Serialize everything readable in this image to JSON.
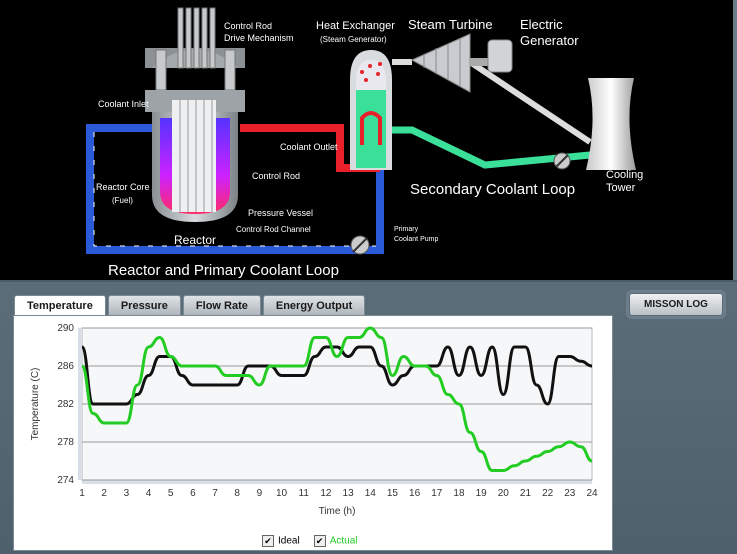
{
  "diagram": {
    "labels": {
      "control_rod_drive": [
        "Control Rod",
        "Drive Mechanism"
      ],
      "heat_exchanger": "Heat Exchanger",
      "steam_generator": "(Steam Generator)",
      "steam_turbine": "Steam Turbine",
      "electric_generator": [
        "Electric",
        "Generator"
      ],
      "coolant_inlet": "Coolant Inlet",
      "coolant_outlet": "Coolant Outlet",
      "control_rod": "Control Rod",
      "reactor_core": [
        "Reactor Core",
        "(Fuel)"
      ],
      "pressure_vessel": "Pressure Vessel",
      "control_rod_channel": "Control Rod Channel",
      "reactor": "Reactor",
      "primary_pump": [
        "Primary",
        "Coolant Pump"
      ],
      "secondary_loop": "Secondary Coolant Loop",
      "cooling_tower": [
        "Cooling",
        "Tower"
      ],
      "primary_loop": "Reactor and Primary Coolant Loop"
    },
    "colors": {
      "primary_hot": "#e8202a",
      "primary_cold": "#2a5ad8",
      "secondary": "#3adf9a"
    }
  },
  "tabs": [
    "Temperature",
    "Pressure",
    "Flow Rate",
    "Energy Output"
  ],
  "active_tab": "Temperature",
  "mission_log_label": "MISSON LOG",
  "legend": {
    "ideal": "Ideal",
    "actual": "Actual"
  },
  "chart_data": {
    "type": "line",
    "xlabel": "Time (h)",
    "ylabel": "Temperature (C)",
    "x": [
      1,
      1.5,
      2,
      2.5,
      3,
      3.5,
      4,
      4.5,
      5,
      5.5,
      6,
      6.5,
      7,
      7.5,
      8,
      8.5,
      9,
      9.5,
      10,
      10.5,
      11,
      11.5,
      12,
      12.5,
      13,
      13.5,
      14,
      14.5,
      15,
      15.5,
      16,
      16.5,
      17,
      17.5,
      18,
      18.5,
      19,
      19.5,
      20,
      20.5,
      21,
      21.5,
      22,
      22.5,
      23,
      23.5,
      24
    ],
    "xlim": [
      1,
      24
    ],
    "ylim": [
      274,
      290
    ],
    "yticks": [
      274,
      278,
      282,
      286,
      290
    ],
    "series": [
      {
        "name": "Ideal",
        "color": "#111111",
        "values": [
          288,
          282,
          282,
          282,
          282,
          283,
          285,
          287,
          287,
          285,
          284,
          284,
          284,
          284,
          284,
          286,
          286,
          286,
          285,
          285,
          285,
          287,
          288,
          288,
          287,
          288,
          288,
          286,
          284,
          285,
          286,
          286,
          286,
          288,
          285,
          288,
          285,
          288,
          283,
          288,
          288,
          284,
          282,
          287,
          287,
          286.5,
          286
        ]
      },
      {
        "name": "Actual",
        "color": "#22cc22",
        "values": [
          286,
          281,
          280,
          280,
          280,
          284,
          288,
          289,
          287,
          286,
          286,
          286,
          286,
          285,
          285,
          285,
          284,
          286,
          286,
          286,
          286,
          289,
          289,
          287,
          289,
          289,
          290,
          289,
          285,
          287,
          286,
          286,
          285,
          283,
          282,
          279,
          277,
          275,
          275,
          275.5,
          276,
          276.5,
          277,
          277.5,
          278,
          277.5,
          276
        ]
      }
    ]
  }
}
